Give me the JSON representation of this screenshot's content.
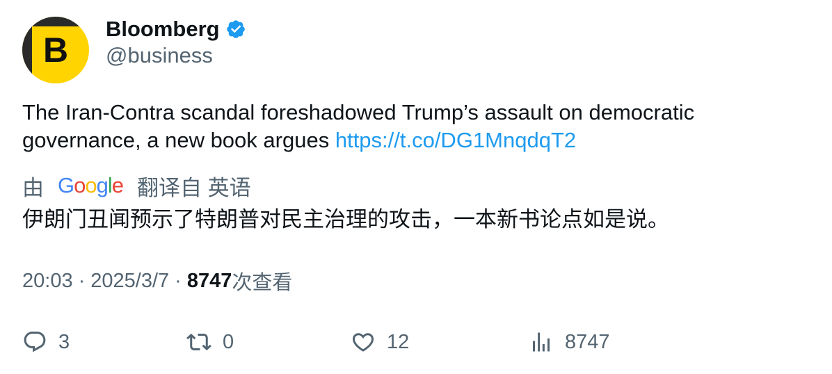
{
  "author": {
    "avatar_letter": "B",
    "avatar_color": "#ffd400",
    "display_name": "Bloomberg",
    "verified_icon": "verified-badge-icon",
    "handle": "@business"
  },
  "tweet": {
    "text": "The Iran-Contra scandal foreshadowed Trump’s assault on democratic governance, a new book argues ",
    "link": "https://t.co/DG1MnqdqT2",
    "link_color": "#1d9bf0"
  },
  "translation": {
    "prefix": "由",
    "provider": "Google",
    "suffix": "翻译自 英语",
    "text": "伊朗门丑闻预示了特朗普对民主治理的攻击，一本新书论点如是说。"
  },
  "meta": {
    "time": "20:03",
    "separator": "·",
    "date": "2025/3/7",
    "views_count": "8747",
    "views_label": "次查看"
  },
  "actions": {
    "reply": {
      "icon": "reply-icon",
      "count": "3"
    },
    "retweet": {
      "icon": "retweet-icon",
      "count": "0"
    },
    "like": {
      "icon": "heart-icon",
      "count": "12"
    },
    "views": {
      "icon": "analytics-icon",
      "count": "8747"
    }
  }
}
